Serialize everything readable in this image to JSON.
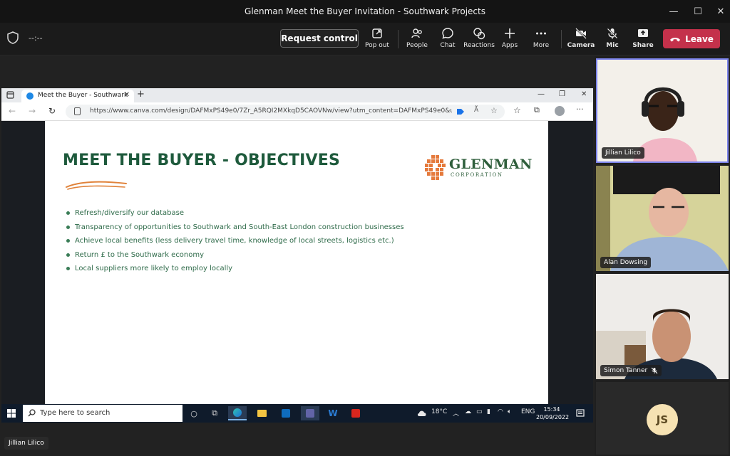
{
  "window": {
    "title": "Glenman Meet the Buyer Invitation - Southwark Projects",
    "minimize": "—",
    "maximize": "☐",
    "close": "✕"
  },
  "toolbar": {
    "timer": "--:--",
    "request_control": "Request control",
    "pop_out": "Pop out",
    "people": "People",
    "chat": "Chat",
    "reactions": "Reactions",
    "apps": "Apps",
    "more": "More",
    "camera": "Camera",
    "mic": "Mic",
    "share": "Share",
    "leave": "Leave"
  },
  "browser": {
    "tab_title": "Meet the Buyer - Southwark",
    "tab_close": "✕",
    "new_tab": "+",
    "url": "https://www.canva.com/design/DAFMxPS49e0/7Zr_A5RQI2MXkqD5CAOVNw/view?utm_content=DAFMxPS49e0&utm_camp...",
    "back": "←",
    "forward": "→",
    "refresh": "↻",
    "menu": "···"
  },
  "slide": {
    "title": "MEET THE BUYER - OBJECTIVES",
    "logo_word": "GLENMAN",
    "logo_sub": "CORPORATION",
    "bullets": [
      "Refresh/diversify our database",
      "Transparency of opportunities to Southwark and South-East London construction businesses",
      "Achieve local benefits (less delivery travel time, knowledge of local streets, logistics etc.)",
      "Return £ to the Southwark economy",
      "Local suppliers more likely to employ locally"
    ]
  },
  "taskbar": {
    "search_placeholder": "Type here to search",
    "temperature": "18°C",
    "language": "ENG",
    "time": "15:34",
    "date": "20/09/2022"
  },
  "participants": [
    {
      "name": "Jillian Lilico"
    },
    {
      "name": "Alan Dowsing"
    },
    {
      "name": "Simon Tanner"
    },
    {
      "initials": "JS"
    }
  ],
  "self_label": "Jillian Lilico",
  "colors": {
    "leave_red": "#c4314b",
    "slide_green": "#1e5a3c",
    "active_border": "#7b83eb"
  }
}
